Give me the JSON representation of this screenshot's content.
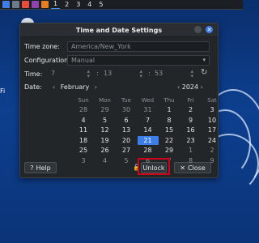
{
  "panel": {
    "workspaces": [
      "1",
      "2",
      "3",
      "4",
      "5"
    ],
    "active_workspace": "1"
  },
  "desktop": {
    "label_fragment": "Fi"
  },
  "dialog": {
    "title": "Time and Date Settings",
    "timezone_label": "Time zone:",
    "timezone_value": "America/New_York",
    "config_label": "Configuration:",
    "config_value": "Manual",
    "time_label": "Time:",
    "hour": "7",
    "minute": "13",
    "second": "53",
    "date_label": "Date:",
    "month": "February",
    "year": "2024",
    "weekdays": [
      "Sun",
      "Mon",
      "Tue",
      "Wed",
      "Thu",
      "Fri",
      "Sat"
    ],
    "weeks": [
      [
        "28",
        "29",
        "30",
        "31",
        "1",
        "2",
        "3"
      ],
      [
        "4",
        "5",
        "6",
        "7",
        "8",
        "9",
        "10"
      ],
      [
        "11",
        "12",
        "13",
        "14",
        "15",
        "16",
        "17"
      ],
      [
        "18",
        "19",
        "20",
        "21",
        "22",
        "23",
        "24"
      ],
      [
        "25",
        "26",
        "27",
        "28",
        "29",
        "1",
        "2"
      ],
      [
        "3",
        "4",
        "5",
        "6",
        "7",
        "8",
        "9"
      ]
    ],
    "selected_day": "21",
    "help_label": "Help",
    "unlock_label": "Unlock",
    "close_label": "Close"
  },
  "colors": {
    "accent": "#3d7ee8",
    "highlight": "#d0021b"
  }
}
